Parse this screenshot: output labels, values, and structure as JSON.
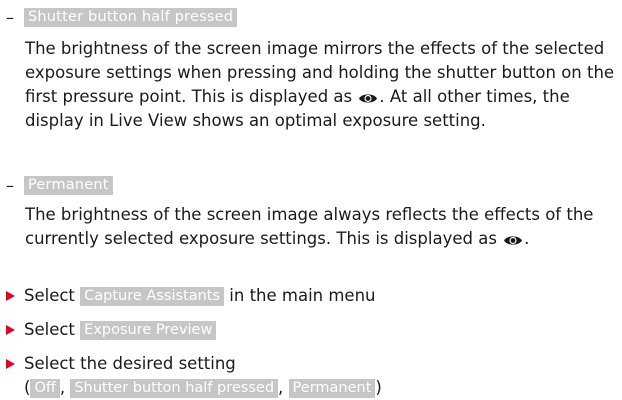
{
  "options": [
    {
      "label": "Shutter button half pressed",
      "description_before_icon": "The brightness of the screen image mirrors the effects of the selected exposure settings when pressing and holding the shutter button on the first pressure point. This is displayed as",
      "description_after_icon": ". At all other times, the display in Live View shows an optimal exposure setting."
    },
    {
      "label": "Permanent",
      "description_before_icon": "The brightness of the screen image always reflects the effects of the currently selected exposure settings. This is displayed as",
      "description_after_icon": "."
    }
  ],
  "steps": [
    {
      "prefix": "Select",
      "tag": "Capture Assistants",
      "suffix": "in the main menu"
    },
    {
      "prefix": "Select",
      "tag": "Exposure Preview",
      "suffix": ""
    },
    {
      "text": "Select the desired setting",
      "open_paren": "(",
      "opt1": "Off",
      "sep1": ",",
      "opt2": "Shutter button half pressed",
      "sep2": ",",
      "opt3": "Permanent",
      "close_paren": ")"
    }
  ],
  "symbols": {
    "dash": "–"
  },
  "colors": {
    "tag_background": "#c6c6c6",
    "tag_text": "#ffffff",
    "bullet": "#e3001b",
    "body_text": "#1a1a1a"
  },
  "icons": {
    "exposure_preview": "eye-icon",
    "step_bullet": "triangle-bullet-icon"
  }
}
